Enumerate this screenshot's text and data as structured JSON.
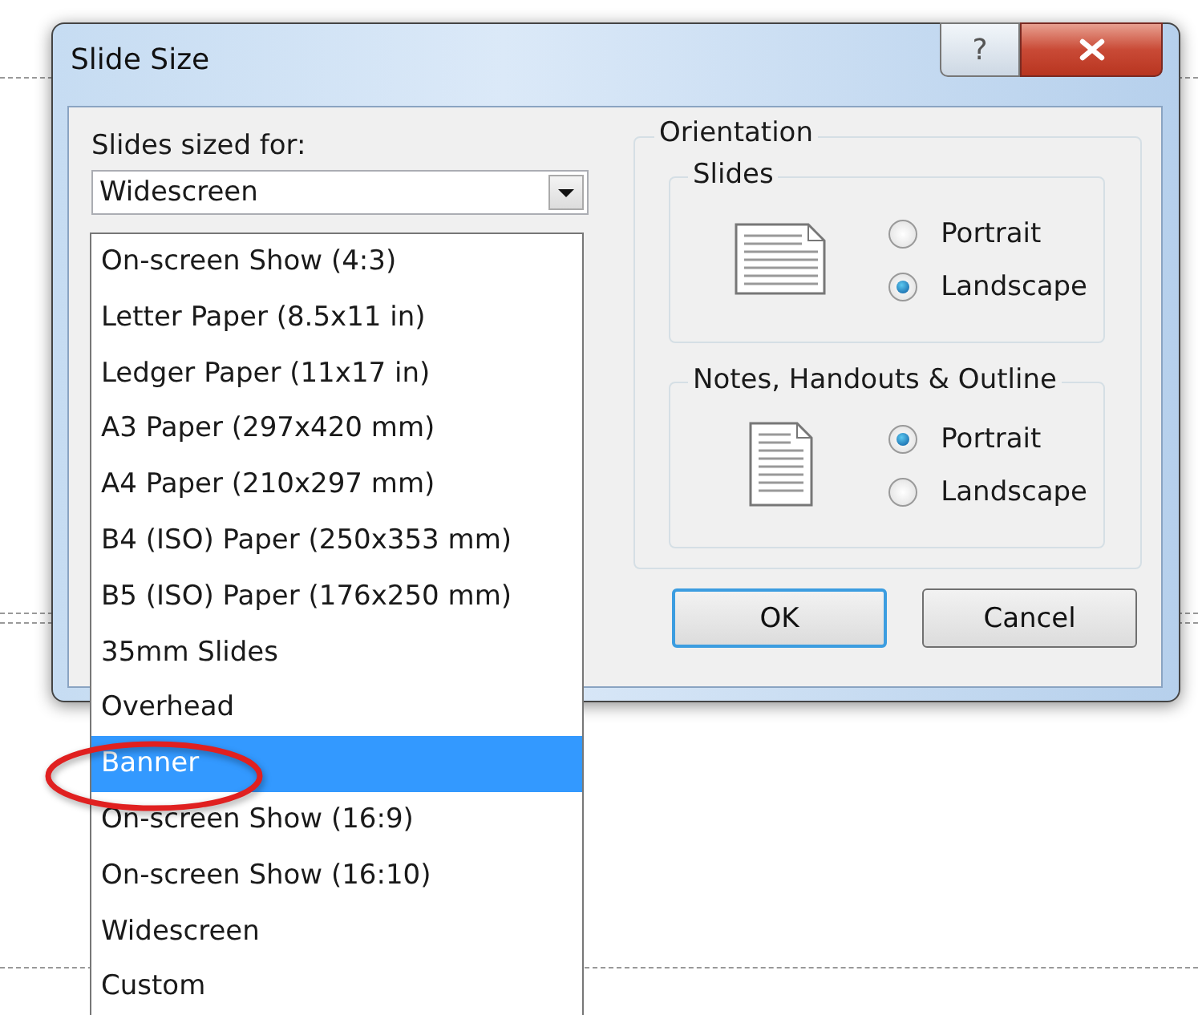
{
  "window": {
    "title": "Slide Size",
    "help_button": "?"
  },
  "slides_sized_for": {
    "label": "Slides sized for:",
    "value": "Widescreen",
    "options": [
      {
        "label": "On-screen Show (4:3)",
        "highlighted": false,
        "circled": false
      },
      {
        "label": "Letter Paper (8.5x11 in)",
        "highlighted": false,
        "circled": false
      },
      {
        "label": "Ledger Paper (11x17 in)",
        "highlighted": false,
        "circled": false
      },
      {
        "label": "A3 Paper (297x420 mm)",
        "highlighted": false,
        "circled": false
      },
      {
        "label": "A4 Paper (210x297 mm)",
        "highlighted": false,
        "circled": false
      },
      {
        "label": "B4 (ISO) Paper (250x353 mm)",
        "highlighted": false,
        "circled": false
      },
      {
        "label": "B5 (ISO) Paper (176x250 mm)",
        "highlighted": false,
        "circled": false
      },
      {
        "label": "35mm Slides",
        "highlighted": false,
        "circled": false
      },
      {
        "label": "Overhead",
        "highlighted": false,
        "circled": false
      },
      {
        "label": "Banner",
        "highlighted": true,
        "circled": true
      },
      {
        "label": "On-screen Show (16:9)",
        "highlighted": false,
        "circled": false
      },
      {
        "label": "On-screen Show (16:10)",
        "highlighted": false,
        "circled": false
      },
      {
        "label": "Widescreen",
        "highlighted": false,
        "circled": false
      },
      {
        "label": "Custom",
        "highlighted": false,
        "circled": false
      }
    ]
  },
  "orientation": {
    "title": "Orientation",
    "groups": [
      {
        "title": "Slides",
        "kind": "landscape",
        "options": [
          {
            "label": "Portrait",
            "selected": false
          },
          {
            "label": "Landscape",
            "selected": true
          }
        ]
      },
      {
        "title": "Notes, Handouts & Outline",
        "kind": "portrait",
        "options": [
          {
            "label": "Portrait",
            "selected": true
          },
          {
            "label": "Landscape",
            "selected": false
          }
        ]
      }
    ]
  },
  "buttons": [
    {
      "label": "OK",
      "default": true
    },
    {
      "label": "Cancel",
      "default": false
    }
  ]
}
